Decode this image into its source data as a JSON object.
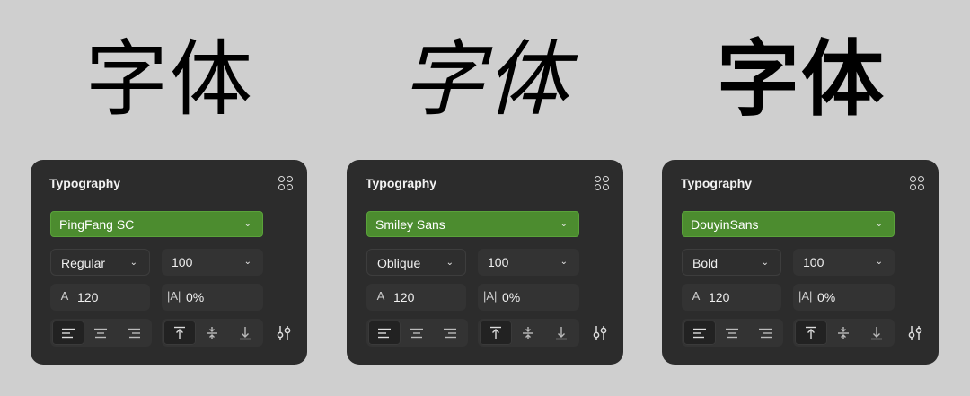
{
  "panels": [
    {
      "sample_text": "字体",
      "title": "Typography",
      "font_family": "PingFang SC",
      "font_style": "Regular",
      "font_size": "100",
      "line_height": "120",
      "letter_spacing": "0%",
      "accent": "#4c8c2f"
    },
    {
      "sample_text": "字体",
      "title": "Typography",
      "font_family": "Smiley Sans",
      "font_style": "Oblique",
      "font_size": "100",
      "line_height": "120",
      "letter_spacing": "0%",
      "accent": "#4c8c2f"
    },
    {
      "sample_text": "字体",
      "title": "Typography",
      "font_family": "DouyinSans",
      "font_style": "Bold",
      "font_size": "100",
      "line_height": "120",
      "letter_spacing": "0%",
      "accent": "#4c8c2f"
    }
  ],
  "icons": {
    "more": "grid-dots-icon",
    "align_left": "align-left-icon",
    "align_center": "align-center-icon",
    "align_right": "align-right-icon",
    "align_top": "align-top-icon",
    "align_middle": "align-middle-icon",
    "align_bottom": "align-bottom-icon",
    "tune": "tune-icon"
  },
  "active_states": {
    "horizontal_align": "left",
    "vertical_align": "top"
  }
}
